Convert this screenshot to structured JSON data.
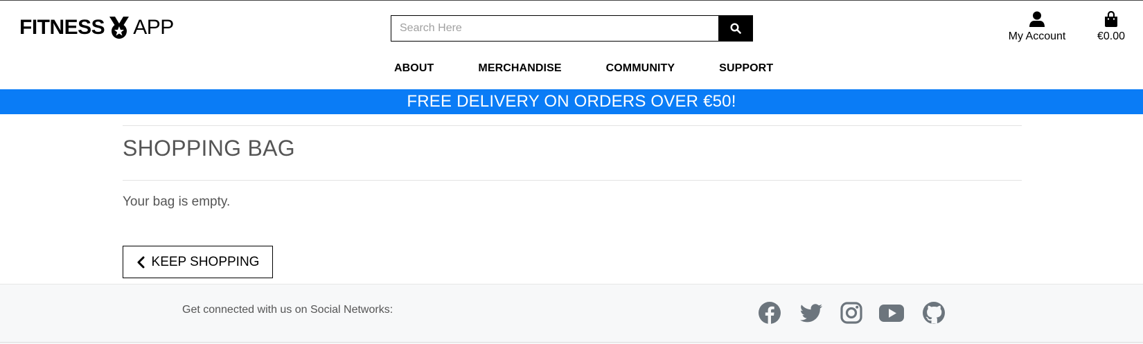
{
  "header": {
    "logo": {
      "part1": "FITNESS",
      "part2": "APP"
    },
    "search": {
      "placeholder": "Search Here",
      "value": ""
    },
    "account": {
      "label": "My Account",
      "icon": "user-icon"
    },
    "bag": {
      "total": "€0.00",
      "icon": "shopping-bag-icon"
    }
  },
  "nav": {
    "items": [
      {
        "label": "ABOUT"
      },
      {
        "label": "MERCHANDISE"
      },
      {
        "label": "COMMUNITY"
      },
      {
        "label": "SUPPORT"
      }
    ]
  },
  "banner": {
    "text": "FREE DELIVERY ON ORDERS OVER €50!",
    "color": "#0a7cf6"
  },
  "main": {
    "title": "SHOPPING BAG",
    "empty_message": "Your bag is empty.",
    "keep_shopping_label": "KEEP SHOPPING"
  },
  "footer": {
    "connect_text": "Get connected with us on Social Networks:",
    "social": [
      {
        "icon": "facebook-icon"
      },
      {
        "icon": "twitter-icon"
      },
      {
        "icon": "instagram-icon"
      },
      {
        "icon": "youtube-icon"
      },
      {
        "icon": "github-icon"
      }
    ],
    "icon_color": "#6c757d"
  }
}
